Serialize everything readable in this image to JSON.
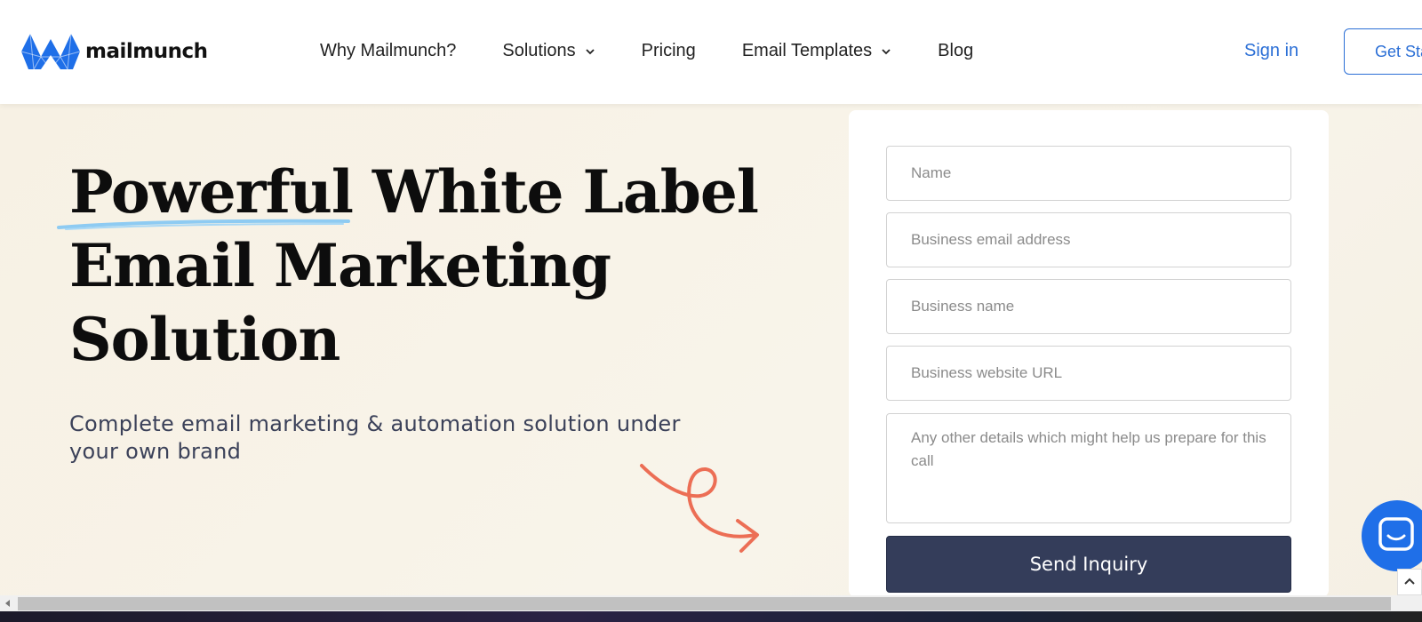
{
  "brand": {
    "name": "mailmunch",
    "color": "#1f6fe8"
  },
  "nav": {
    "items": [
      {
        "label": "Why Mailmunch?",
        "dropdown": false
      },
      {
        "label": "Solutions",
        "dropdown": true
      },
      {
        "label": "Pricing",
        "dropdown": false
      },
      {
        "label": "Email Templates",
        "dropdown": true
      },
      {
        "label": "Blog",
        "dropdown": false
      }
    ],
    "sign_in": "Sign in",
    "get_started": "Get Sta"
  },
  "hero": {
    "headline_word1": "Powerful",
    "headline_rest1": "White Label",
    "headline_line2": "Email Marketing",
    "headline_line3": "Solution",
    "subtitle": "Complete email marketing & automation solution under your own brand"
  },
  "form": {
    "name_placeholder": "Name",
    "email_placeholder": "Business email address",
    "business_name_placeholder": "Business name",
    "website_placeholder": "Business website URL",
    "details_placeholder": "Any other details which might help us prepare for this call",
    "submit_label": "Send Inquiry"
  },
  "colors": {
    "accent": "#2b6fd6",
    "button": "#343d5a",
    "hero_bg": "#f8f3e8",
    "arrow": "#ec6e55",
    "underline": "#8ecbf2"
  },
  "icons": [
    "logo-mark-icon",
    "chevron-down-icon",
    "chat-icon",
    "arrow-doodle-icon",
    "chevron-up-icon"
  ]
}
